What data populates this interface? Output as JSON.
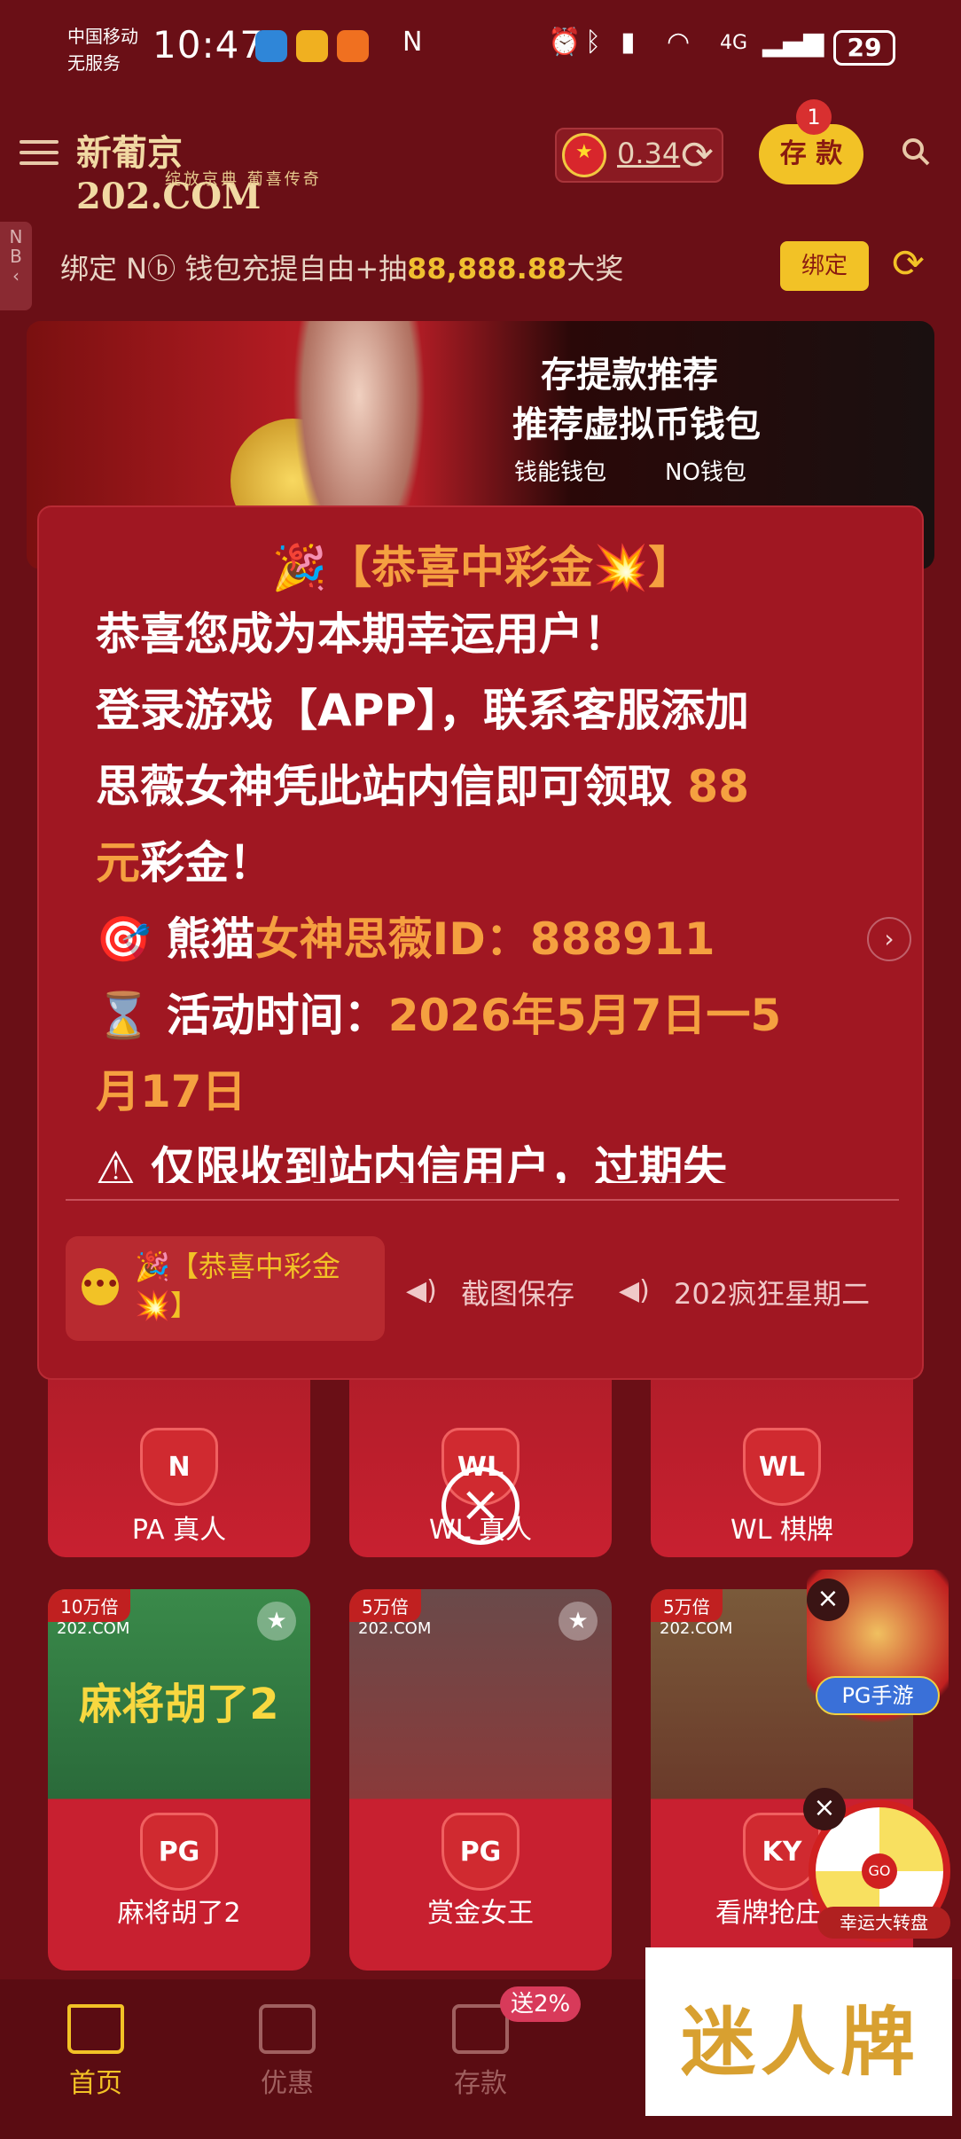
{
  "status_bar": {
    "carrier_line1": "中国移动",
    "carrier_line2": "无服务",
    "time": "10:47",
    "network": "4G",
    "battery": "29"
  },
  "header": {
    "logo_main": "新葡京202.COM",
    "logo_sub": "绽放京典 葡喜传奇",
    "flag_glyph": "★",
    "balance": "0.34",
    "deposit_label": "存 款",
    "deposit_badge": "1"
  },
  "notice": {
    "side_label": "N\nB",
    "text_prefix": "绑定 N",
    "text_mid": " 钱包充提自由+抽",
    "text_highlight": "88,888.88",
    "text_suffix": "大奖",
    "bind_label": "绑定"
  },
  "banner": {
    "title1": "存提款推荐",
    "title2": "推荐虚拟币钱包",
    "wallet1": "钱能钱包",
    "wallet2": "NO钱包"
  },
  "popup": {
    "title": "🎉【恭喜中彩金💥】",
    "line1": "恭喜您成为本期幸运用户！",
    "line2": "登录游戏【APP】，联系客服添加",
    "line3a": "思薇女神凭此站内信即可领取 ",
    "line3b": "88",
    "line4a": "元",
    "line4b": "彩金！",
    "line5_icon": "🎯",
    "line5a": " 熊猫",
    "line5b": "女神思薇ID：888911",
    "line6_icon": "⌛",
    "line6a": " 活动时间：",
    "line6b": "2026年5月7日一5",
    "line7": "月17日",
    "line8": "⚠ 仅限收到站内信用户，过期失",
    "next_icon": "›",
    "tabs": {
      "active": "🎉【恭喜中彩金💥】",
      "tab2": "截图保存",
      "tab3": "202疯狂星期二"
    },
    "chat_icon_glyph": "•••",
    "speaker_glyph": "◀)"
  },
  "close_glyph": "×",
  "tiles_row1": [
    {
      "label": "PA 真人",
      "logo": "N"
    },
    {
      "label": "WL 真人",
      "logo": "WL"
    },
    {
      "label": "WL 棋牌",
      "logo": "WL"
    }
  ],
  "tiles_row2": [
    {
      "label": "麻将胡了2",
      "logo": "PG",
      "mult": "10万倍",
      "brand": "202.COM",
      "art": "麻将胡了2"
    },
    {
      "label": "赏金女王",
      "logo": "PG",
      "mult": "5万倍",
      "brand": "202.COM"
    },
    {
      "label": "看牌抢庄牛",
      "logo": "KY",
      "mult": "5万倍",
      "brand": "202.COM"
    }
  ],
  "floats": {
    "close_glyph": "×",
    "god_label": "PG手游",
    "wheel_center": "GO",
    "wheel_label": "幸运大转盘"
  },
  "bottom_nav": [
    {
      "label": "首页",
      "active": true
    },
    {
      "label": "优惠",
      "active": false
    },
    {
      "label": "存款",
      "active": false,
      "badge": "送2%"
    }
  ],
  "watermark": "迷人牌",
  "colors": {
    "bg": "#6a0f16",
    "popup": "#a01722",
    "accent_gold": "#f2c226",
    "highlight_orange": "#f5a040"
  }
}
